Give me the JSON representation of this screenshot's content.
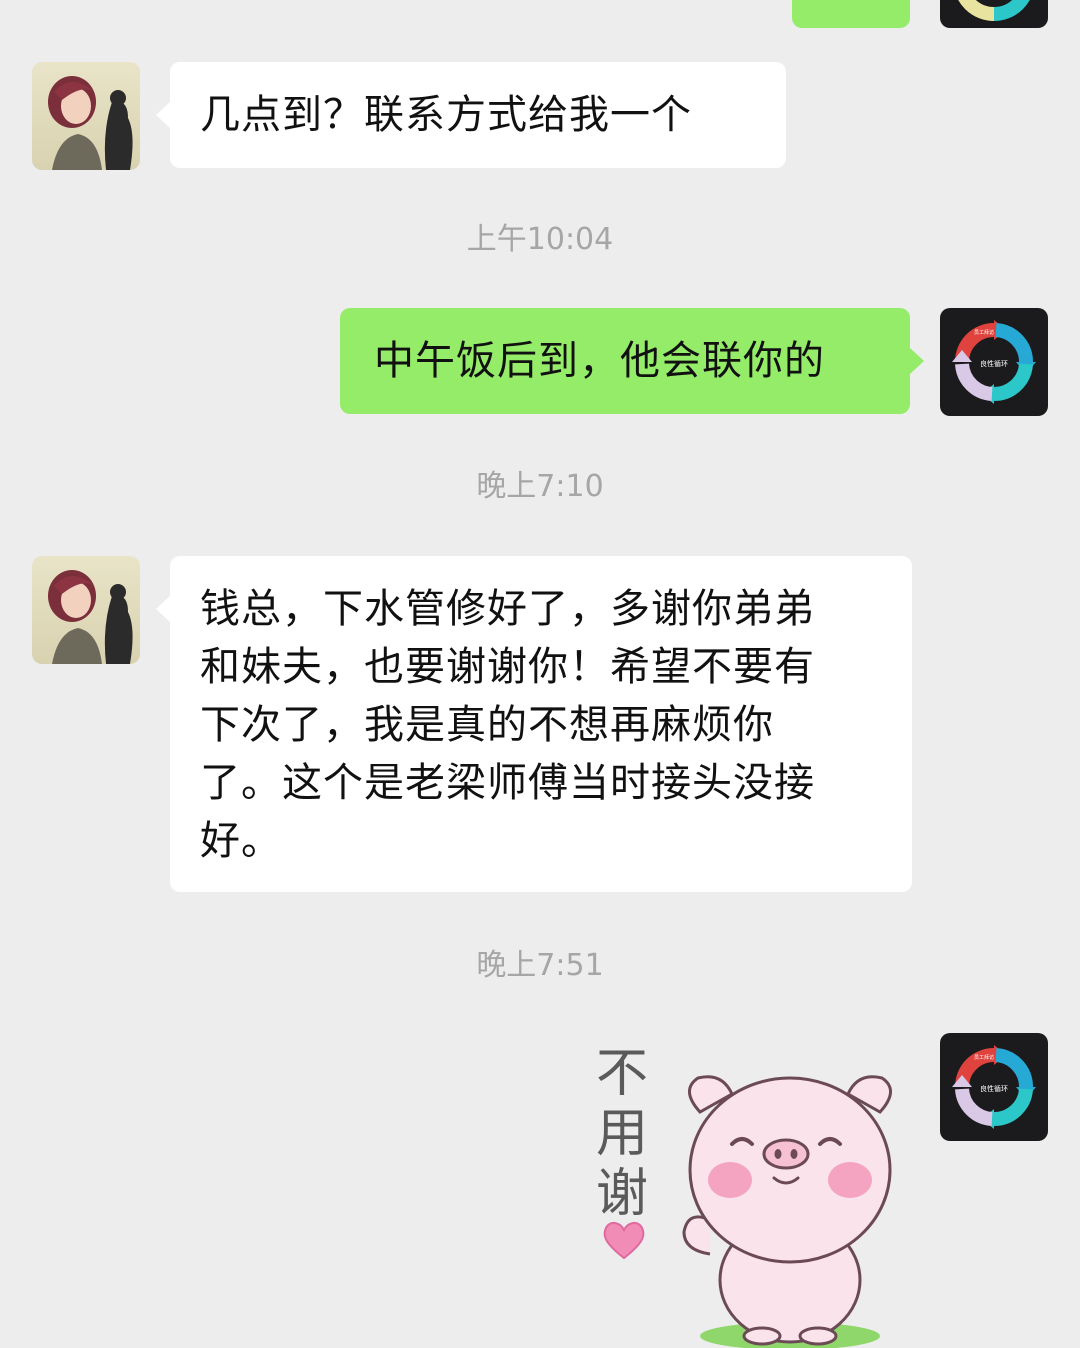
{
  "colors": {
    "background": "#ededed",
    "incoming_bubble": "#ffffff",
    "outgoing_bubble": "#95ec69",
    "timestamp_text": "#a6a6a6"
  },
  "messages": [
    {
      "type": "incoming",
      "sender": "contact",
      "text": "几点到？联系方式给我一个"
    },
    {
      "type": "timestamp",
      "text": "上午10:04"
    },
    {
      "type": "outgoing",
      "sender": "me",
      "text": "中午饭后到，他会联你的"
    },
    {
      "type": "timestamp",
      "text": "晚上7:10"
    },
    {
      "type": "incoming",
      "sender": "contact",
      "lines": [
        "钱总，下水管修好了，多谢你弟弟",
        "和妹夫，也要谢谢你！希望不要有",
        "下次了，我是真的不想再麻烦你",
        "了。这个是老梁师傅当时接头没接",
        "好。"
      ]
    },
    {
      "type": "timestamp",
      "text": "晚上7:51"
    },
    {
      "type": "sticker",
      "sender": "me",
      "sticker_text": [
        "不",
        "用",
        "谢"
      ],
      "icon": "pig-sticker"
    }
  ],
  "my_avatar": {
    "icon": "cycle-diagram-avatar",
    "labels": [
      "员工拜访",
      "良性循环"
    ]
  }
}
